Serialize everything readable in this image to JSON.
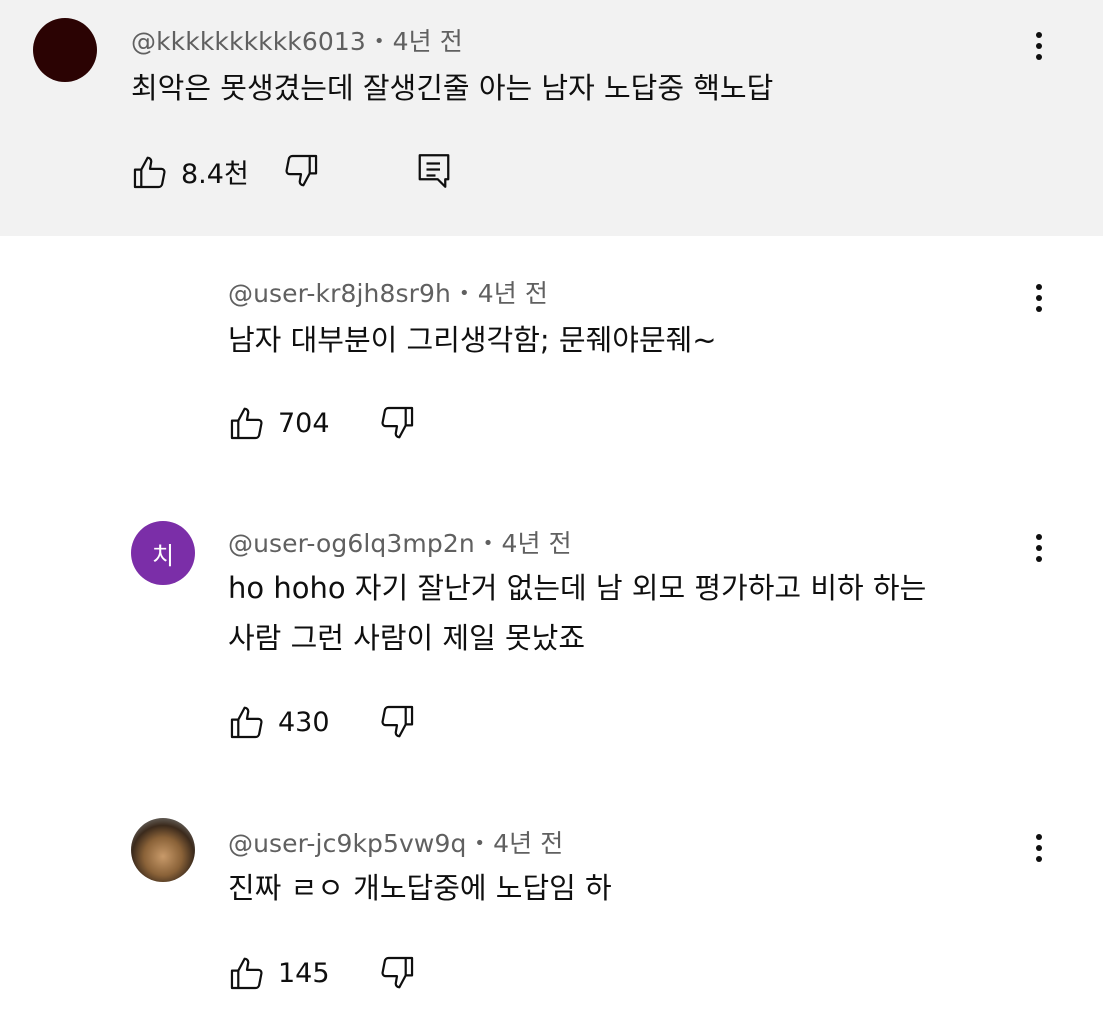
{
  "comments": [
    {
      "author": "@kkkkkkkkkk6013",
      "time": "4년 전",
      "text_lines": [
        "최악은 못생겼는데 잘생긴줄 아는 남자  노답중 핵노답"
      ],
      "likes": "8.4천",
      "avatar_color": "#2b0303",
      "avatar_letter": ""
    },
    {
      "author": "@user-kr8jh8sr9h",
      "time": "4년 전",
      "text_lines": [
        "남자 대부분이 그리생각함; 문줴야문줴~"
      ],
      "likes": "704"
    },
    {
      "author": "@user-og6lq3mp2n",
      "time": "4년 전",
      "text_lines": [
        "ho hoho 자기 잘난거 없는데 남 외모 평가하고 비하 하는",
        "사람 그런 사람이 제일 못났죠"
      ],
      "likes": "430",
      "avatar_color": "#7b2ea8",
      "avatar_letter": "치"
    },
    {
      "author": "@user-jc9kp5vw9q",
      "time": "4년 전",
      "text_lines": [
        "진짜 ㄹㅇ 개노답중에 노답임 하"
      ],
      "likes": "145"
    }
  ],
  "separator": "•",
  "icons": {
    "like": "thumbs-up-icon",
    "dislike": "thumbs-down-icon",
    "reply": "reply-icon",
    "more": "more-vertical-icon"
  }
}
